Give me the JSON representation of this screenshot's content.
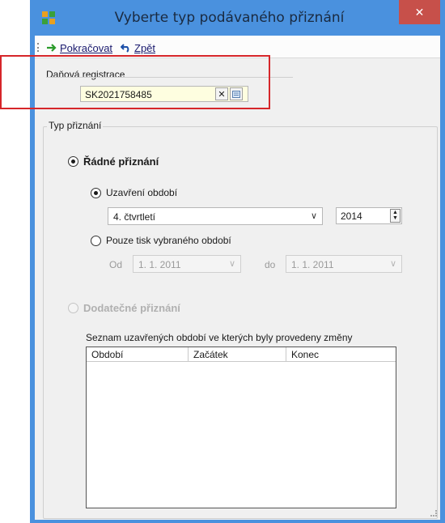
{
  "window": {
    "title": "Vyberte typ podávaného přiznání",
    "close_symbol": "✕"
  },
  "toolbar": {
    "continue_label": "Pokračovat",
    "back_label": "Zpět"
  },
  "tax_registration": {
    "group_title": "Daňová registrace",
    "value": "SK2021758485",
    "clear_symbol": "✕"
  },
  "return_type": {
    "group_title": "Typ přiznání",
    "regular": {
      "label": "Řádné přiznání",
      "close_period": {
        "label": "Uzavření období",
        "period_select": "4. čtvrtletí",
        "year": "2014"
      },
      "print_only": {
        "label": "Pouze tisk vybraného období",
        "from_label": "Od",
        "from_value": "1. 1. 2011",
        "to_label": "do",
        "to_value": "1. 1. 2011"
      }
    },
    "supplementary": {
      "label": "Dodatečné přiznání",
      "list_caption": "Seznam uzavřených období ve kterých byly provedeny změny",
      "columns": [
        "Období",
        "Začátek",
        "Konec"
      ]
    }
  },
  "colors": {
    "title_bar": "#4a91de",
    "close_button": "#c7504a",
    "highlight_box": "#d6262a",
    "input_bg": "#fefee0"
  }
}
